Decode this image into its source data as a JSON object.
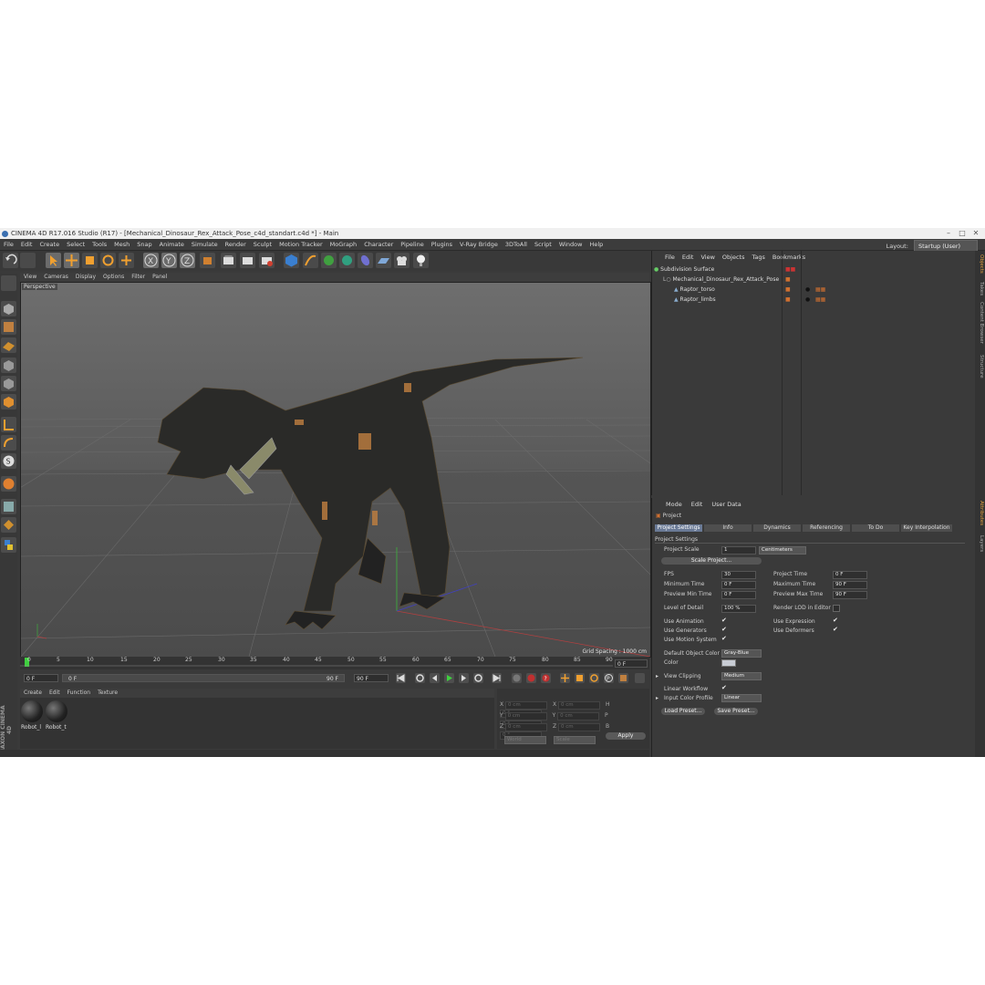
{
  "window": {
    "title": "CINEMA 4D R17.016 Studio (R17) - [Mechanical_Dinosaur_Rex_Attack_Pose_c4d_standart.c4d *] - Main"
  },
  "menu": [
    "File",
    "Edit",
    "Create",
    "Select",
    "Tools",
    "Mesh",
    "Snap",
    "Animate",
    "Simulate",
    "Render",
    "Sculpt",
    "Motion Tracker",
    "MoGraph",
    "Character",
    "Pipeline",
    "Plugins",
    "V-Ray Bridge",
    "3DToAll",
    "Script",
    "Window",
    "Help"
  ],
  "layout": {
    "label": "Layout:",
    "value": "Startup (User)"
  },
  "viewport": {
    "menu": [
      "View",
      "Cameras",
      "Display",
      "Options",
      "Filter",
      "Panel"
    ],
    "camera": "Perspective",
    "grid_spacing": "Grid Spacing : 1000 cm"
  },
  "timeline": {
    "ticks": [
      "0",
      "5",
      "10",
      "15",
      "20",
      "25",
      "30",
      "35",
      "40",
      "45",
      "50",
      "55",
      "60",
      "65",
      "70",
      "75",
      "80",
      "85",
      "90"
    ],
    "current": "0 F",
    "start": "0 F",
    "end": "90 F",
    "end_field": "90 F",
    "end_frame": "0 F"
  },
  "materials": {
    "menu": [
      "Create",
      "Edit",
      "Function",
      "Texture"
    ],
    "items": [
      "Robot_l",
      "Robot_t"
    ]
  },
  "coords": {
    "rows": [
      {
        "a": "X",
        "b": "X",
        "c": "H"
      },
      {
        "a": "Y",
        "b": "Y",
        "c": "P"
      },
      {
        "a": "Z",
        "b": "Z",
        "c": "B"
      }
    ],
    "val_cm": "0 cm",
    "val_deg": "0 °",
    "mode": "World",
    "mode2": "Scale",
    "apply": "Apply"
  },
  "objects": {
    "menu": [
      "File",
      "Edit",
      "View",
      "Objects",
      "Tags",
      "Bookmarks"
    ],
    "rows": [
      "Subdivision Surface",
      "Mechanical_Dinosaur_Rex_Attack_Pose",
      "Raptor_torso",
      "Raptor_limbs"
    ]
  },
  "attributes": {
    "menu": [
      "Mode",
      "Edit",
      "User Data"
    ],
    "object": "Project",
    "tabs": [
      "Project Settings",
      "Info",
      "Dynamics",
      "Referencing",
      "To Do",
      "Key Interpolation"
    ],
    "section": "Project Settings",
    "project_scale_label": "Project Scale",
    "project_scale": "1",
    "project_scale_unit": "Centimeters",
    "scale_project_btn": "Scale Project...",
    "fps_label": "FPS",
    "fps": "30",
    "project_time_label": "Project Time",
    "project_time": "0 F",
    "min_time_label": "Minimum Time",
    "min_time": "0 F",
    "max_time_label": "Maximum Time",
    "max_time": "90 F",
    "prev_min_label": "Preview Min Time",
    "prev_min": "0 F",
    "prev_max_label": "Preview Max Time",
    "prev_max": "90 F",
    "lod_label": "Level of Detail",
    "lod": "100 %",
    "render_lod_label": "Render LOD in Editor",
    "use_animation": "Use Animation",
    "use_expression": "Use Expression",
    "use_generators": "Use Generators",
    "use_deformers": "Use Deformers",
    "use_motion": "Use Motion System",
    "default_color_label": "Default Object Color",
    "default_color": "Gray-Blue",
    "color_label": "Color",
    "view_clipping_label": "View Clipping",
    "view_clipping": "Medium",
    "linear_workflow": "Linear Workflow",
    "input_color_label": "Input Color Profile",
    "input_color": "Linear",
    "load_preset": "Load Preset...",
    "save_preset": "Save Preset..."
  },
  "side_tabs": [
    "Objects",
    "Takes",
    "Content Browser",
    "Structure"
  ],
  "side_tabs2": [
    "Attributes",
    "Layers"
  ],
  "brand": "MAXON CINEMA 4D"
}
